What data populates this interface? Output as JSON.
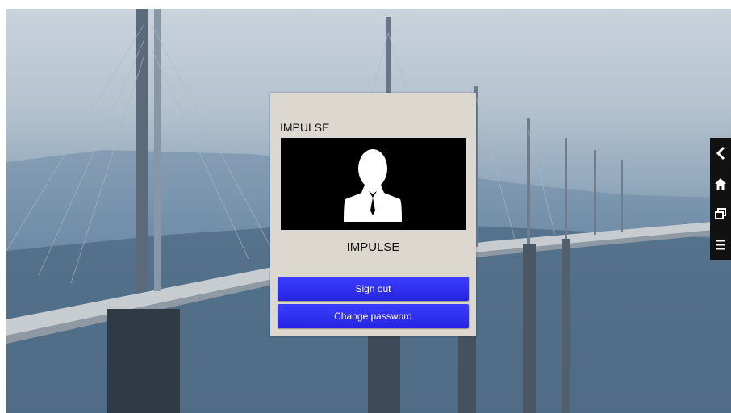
{
  "panel": {
    "title": "IMPULSE",
    "user_name": "IMPULSE",
    "avatar_icon": "user-silhouette-icon"
  },
  "buttons": {
    "sign_out": "Sign out",
    "change_password": "Change password"
  },
  "side_nav": {
    "items": [
      {
        "icon": "back-chevron-icon"
      },
      {
        "icon": "home-icon"
      },
      {
        "icon": "window-switch-icon"
      },
      {
        "icon": "menu-icon"
      }
    ]
  },
  "colors": {
    "panel_bg": "#dcd7cf",
    "button_blue": "#2f2ff0",
    "side_nav_bg": "#111111"
  }
}
